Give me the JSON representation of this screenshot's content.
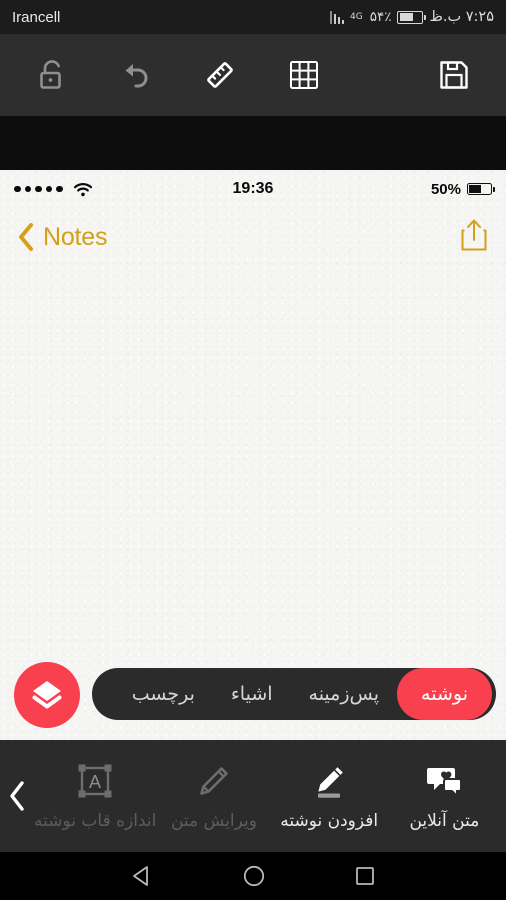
{
  "android_status": {
    "clock": "۷:۲۵ ب.ظ",
    "battery_percent": "۵۴٪",
    "battery_level": 54,
    "network_type": "4G",
    "carrier": "Irancell"
  },
  "app_toolbar": {
    "items": [
      {
        "name": "lock-icon",
        "label": "قفل",
        "enabled": false
      },
      {
        "name": "undo-icon",
        "label": "واگرد",
        "enabled": false
      },
      {
        "name": "ruler-icon",
        "label": "خط‌کش",
        "enabled": true
      },
      {
        "name": "grid-icon",
        "label": "شبکه",
        "enabled": true
      },
      {
        "name": "save-icon",
        "label": "ذخیره",
        "enabled": true
      }
    ]
  },
  "ios_status": {
    "signal_dots": 5,
    "wifi": "wifi-icon",
    "time": "19:36",
    "battery_percent": "50%",
    "battery_level": 50
  },
  "ios_nav": {
    "back_label": "Notes",
    "share_icon": "share-icon"
  },
  "tabs": {
    "items": [
      {
        "label": "نوشته",
        "active": true
      },
      {
        "label": "پس‌زمینه",
        "active": false
      },
      {
        "label": "اشیاء",
        "active": false
      },
      {
        "label": "برچسب",
        "active": false
      }
    ],
    "fab_icon": "layers-icon",
    "accent_color": "#f8404e"
  },
  "bottom_tools": {
    "items": [
      {
        "label": "متن آنلاین",
        "icon": "chat-heart-icon",
        "enabled": true
      },
      {
        "label": "افزودن نوشته",
        "icon": "pencil-underline-icon",
        "enabled": true
      },
      {
        "label": "ویرایش متن",
        "icon": "pencil-icon",
        "enabled": false
      },
      {
        "label": "اندازه قاب نوشته",
        "icon": "text-frame-icon",
        "enabled": false
      }
    ],
    "back_icon": "chevron-left-icon"
  },
  "android_nav": {
    "back": "back-triangle-icon",
    "home": "home-circle-icon",
    "recents": "recents-square-icon"
  },
  "colors": {
    "accent": "#f8404e",
    "ios_tint": "#d4a017",
    "toolbar_bg": "#2e2e2e",
    "paper": "#f5f5f3"
  }
}
